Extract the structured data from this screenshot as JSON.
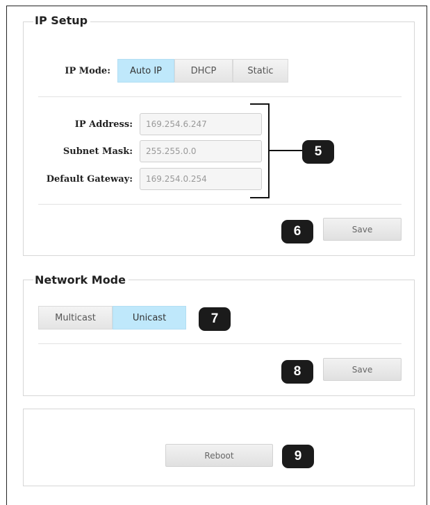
{
  "ip_setup": {
    "title": "IP Setup",
    "ip_mode_label": "IP Mode:",
    "modes": [
      "Auto IP",
      "DHCP",
      "Static"
    ],
    "selected_mode": "Auto IP",
    "fields": {
      "ip_address": {
        "label": "IP Address:",
        "value": "169.254.6.247"
      },
      "subnet_mask": {
        "label": "Subnet Mask:",
        "value": "255.255.0.0"
      },
      "default_gateway": {
        "label": "Default Gateway:",
        "value": "169.254.0.254"
      }
    },
    "save_label": "Save"
  },
  "network_mode": {
    "title": "Network Mode",
    "modes": [
      "Multicast",
      "Unicast"
    ],
    "selected_mode": "Unicast",
    "save_label": "Save"
  },
  "reboot": {
    "label": "Reboot"
  },
  "callouts": {
    "fields": "5",
    "ip_save": "6",
    "network_mode": "7",
    "network_save": "8",
    "reboot": "9"
  },
  "colors": {
    "active_segment": "#bfe8fb",
    "callout": "#1b1b1b"
  }
}
